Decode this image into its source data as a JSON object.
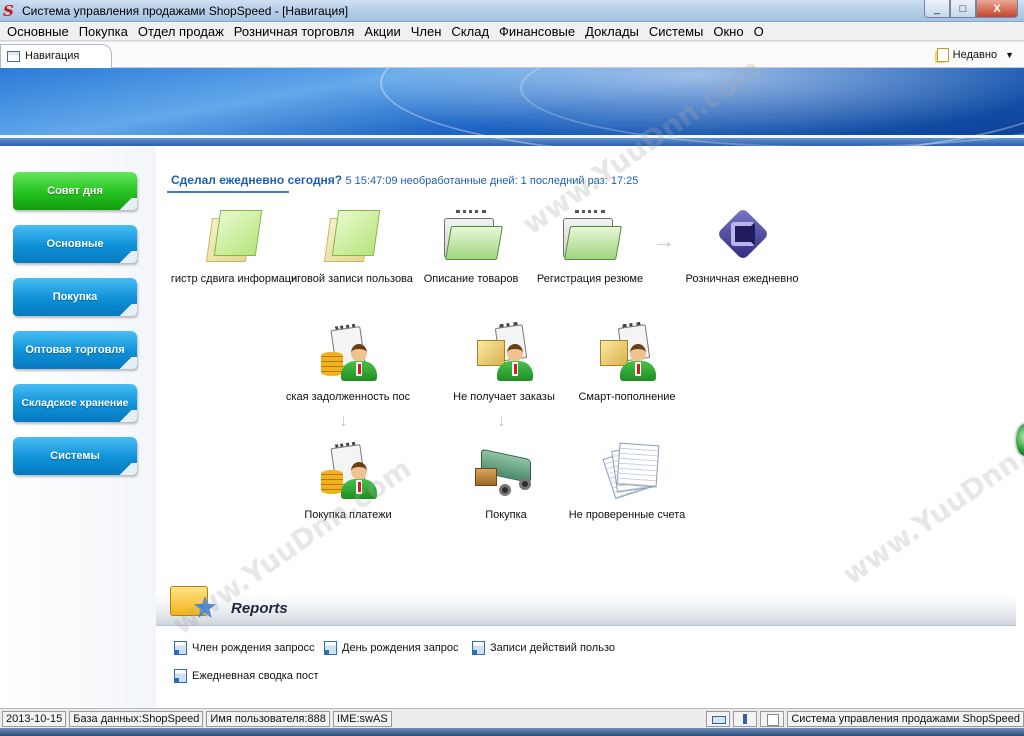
{
  "window": {
    "title": "Система управления продажами ShopSpeed - [Навигация]",
    "buttons": [
      "_",
      "□",
      "X"
    ]
  },
  "menu": [
    "Основные",
    "Покупка",
    "Отдел продаж",
    "Розничная торговля",
    "Акции",
    "Член",
    "Склад",
    "Финансовые",
    "Доклады",
    "Системы",
    "Окно",
    "О"
  ],
  "tab": {
    "label": "Навигация",
    "icon": "navigation-panel-icon"
  },
  "recent": {
    "label": "Недавно",
    "icon": "recent-documents-icon"
  },
  "sidebar": {
    "items": [
      {
        "label": "Совет дня",
        "color": "#25c21f"
      },
      {
        "label": "Основные",
        "color": "#0e91d8"
      },
      {
        "label": "Покупка",
        "color": "#0e91d8"
      },
      {
        "label": "Оптовая торговля",
        "color": "#0e91d8"
      },
      {
        "label": "Складское хранение",
        "color": "#0e91d8"
      },
      {
        "label": "Системы",
        "color": "#0e91d8"
      }
    ]
  },
  "daily": {
    "question": "Сделал ежедневно сегодня?",
    "info": "5 15:47:09 необработанные дней: 1 последний раз:   17:25"
  },
  "flow": {
    "row1": [
      {
        "label": "гистр сдвига информаци",
        "icon": "green-pages-icon"
      },
      {
        "label": "нговой записи пользова",
        "icon": "green-pages-icon"
      },
      {
        "label": "Описание товаров",
        "icon": "green-folder-icon"
      },
      {
        "label": "Регистрация резюме",
        "icon": "green-folder-icon"
      },
      {
        "label": "Розничная ежедневно",
        "icon": "cube-logo-icon"
      }
    ],
    "row2": [
      {
        "label": "ская задолженность пос",
        "icon": "coins-person-icon"
      },
      {
        "label": "Не получает заказы",
        "icon": "box-person-icon"
      },
      {
        "label": "Смарт-пополнение",
        "icon": "box-person-icon"
      }
    ],
    "row3": [
      {
        "label": "Покупка платежи",
        "icon": "coins-person-icon"
      },
      {
        "label": "Покупка",
        "icon": "truck-icon"
      },
      {
        "label": "Не проверенные счета",
        "icon": "paper-stack-icon"
      }
    ]
  },
  "reports": {
    "title": "Reports",
    "links": [
      "Член рождения запросс",
      "День рождения запрос",
      "Записи действий пользо",
      "Ежедневная сводка пост"
    ]
  },
  "status": {
    "date": "2013-10-15",
    "database": "База данных:ShopSpeed",
    "user": "Имя пользователя:888",
    "ime": "IME:swAS",
    "app": "Система управления продажами ShopSpeed"
  },
  "watermark": "www.YuuDnn.com",
  "colors": {
    "accent": "#1d5fb8",
    "nav_blue": "#0e91d8",
    "nav_green": "#25c21f"
  }
}
